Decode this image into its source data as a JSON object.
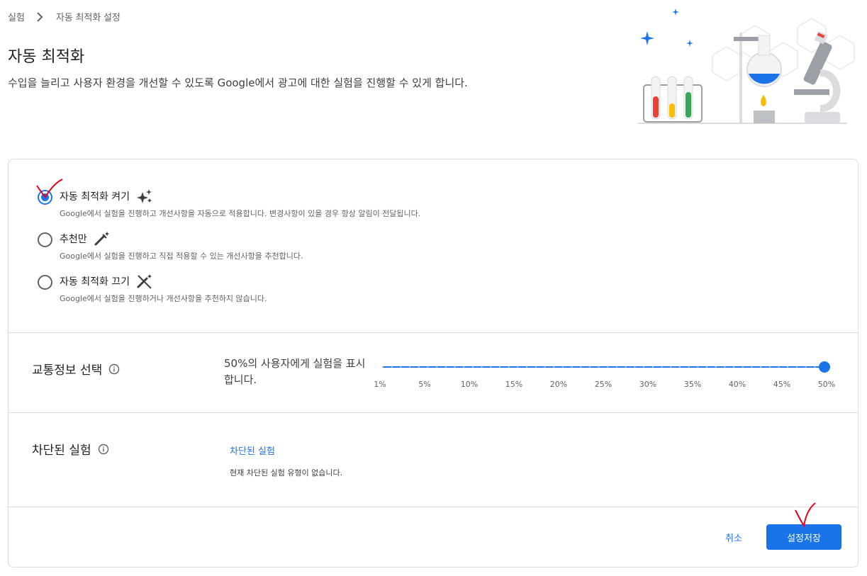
{
  "breadcrumb": {
    "items": [
      "실험",
      "자동 최적화 설정"
    ]
  },
  "header": {
    "title": "자동 최적화",
    "description": "수입을 늘리고 사용자 환경을 개선할 수 있도록 Google에서 광고에 대한 실험을 진행할 수 있게 합니다."
  },
  "options": [
    {
      "label": "자동 최적화 켜기",
      "description": "Google에서 실험을 진행하고 개선사항을 자동으로 적용합니다. 변경사항이 있을 경우 항상 알림이 전달됩니다.",
      "selected": true,
      "icon": "sparkle-icon"
    },
    {
      "label": "추천만",
      "description": "Google에서 실험을 진행하고 직접 적용할 수 있는 개선사항을 추천합니다.",
      "selected": false,
      "icon": "magic-wand-icon"
    },
    {
      "label": "자동 최적화 끄기",
      "description": "Google에서 실험을 진행하거나 개선사항을 추천하지 않습니다.",
      "selected": false,
      "icon": "magic-wand-off-icon"
    }
  ],
  "traffic": {
    "title": "교통정보 선택",
    "summary": "50%의 사용자에게 실험을 표시합니다.",
    "ticks": [
      "1%",
      "5%",
      "10%",
      "15%",
      "20%",
      "25%",
      "30%",
      "35%",
      "40%",
      "45%",
      "50%"
    ],
    "value_percent": 50
  },
  "blocked": {
    "title": "차단된 실험",
    "link": "차단된 실험",
    "description": "현재 차단된 실험 유형이 없습니다."
  },
  "footer": {
    "cancel_label": "취소",
    "save_label": "설정저장"
  },
  "colors": {
    "accent": "#1a73e8",
    "annotation": "#e8001c"
  }
}
